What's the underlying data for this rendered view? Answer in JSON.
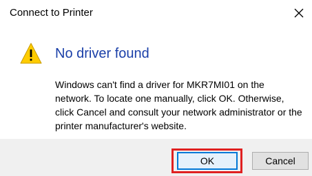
{
  "dialog": {
    "title": "Connect to Printer",
    "close_icon": "close-icon",
    "warning_icon": "warning-icon",
    "heading": "No driver found",
    "message": "Windows can't find a driver for MKR7MI01 on the network. To locate one manually, click OK. Otherwise, click Cancel and consult your network administrator or the printer manufacturer's website.",
    "buttons": {
      "ok_label": "OK",
      "cancel_label": "Cancel"
    }
  },
  "colors": {
    "heading": "#1a3fa8",
    "highlight": "#e02020",
    "default_button_border": "#0078d7",
    "footer_background": "#f0f0f0",
    "warning_fill": "#ffcc00"
  }
}
